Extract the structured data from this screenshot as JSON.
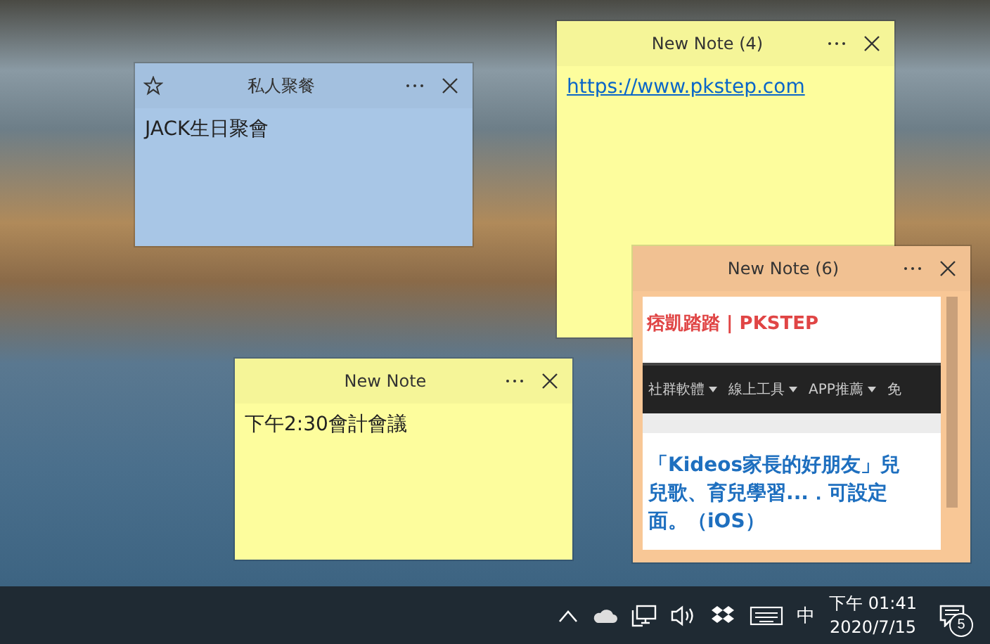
{
  "notes": [
    {
      "kind": "text",
      "title": "私人聚餐",
      "color": "#a8c6e6",
      "starred": true,
      "text": "JACK生日聚會"
    },
    {
      "kind": "link",
      "title": "New Note (4)",
      "color": "#fdfd9d",
      "starred": false,
      "text": "https://www.pkstep.com"
    },
    {
      "kind": "webpage",
      "title": "New Note (6)",
      "color": "#f8c796",
      "starred": false,
      "page": {
        "site_title": "痞凱踏踏 | PKSTEP",
        "nav": [
          {
            "label": "社群軟體",
            "dropdown": true
          },
          {
            "label": "線上工具",
            "dropdown": true
          },
          {
            "label": "APP推薦",
            "dropdown": true
          },
          {
            "label": "免",
            "dropdown": false
          }
        ],
        "headline": [
          "「Kideos家長的好朋友」兒",
          "兒歌、育兒學習...．可設定",
          "面。（iOS）"
        ]
      }
    },
    {
      "kind": "text",
      "title": "New Note",
      "color": "#fdfd9d",
      "starred": false,
      "text": "下午2:30會計會議"
    }
  ],
  "taskbar": {
    "input_method": "中",
    "time": "下午 01:41",
    "date": "2020/7/15",
    "notification_count": "5"
  }
}
